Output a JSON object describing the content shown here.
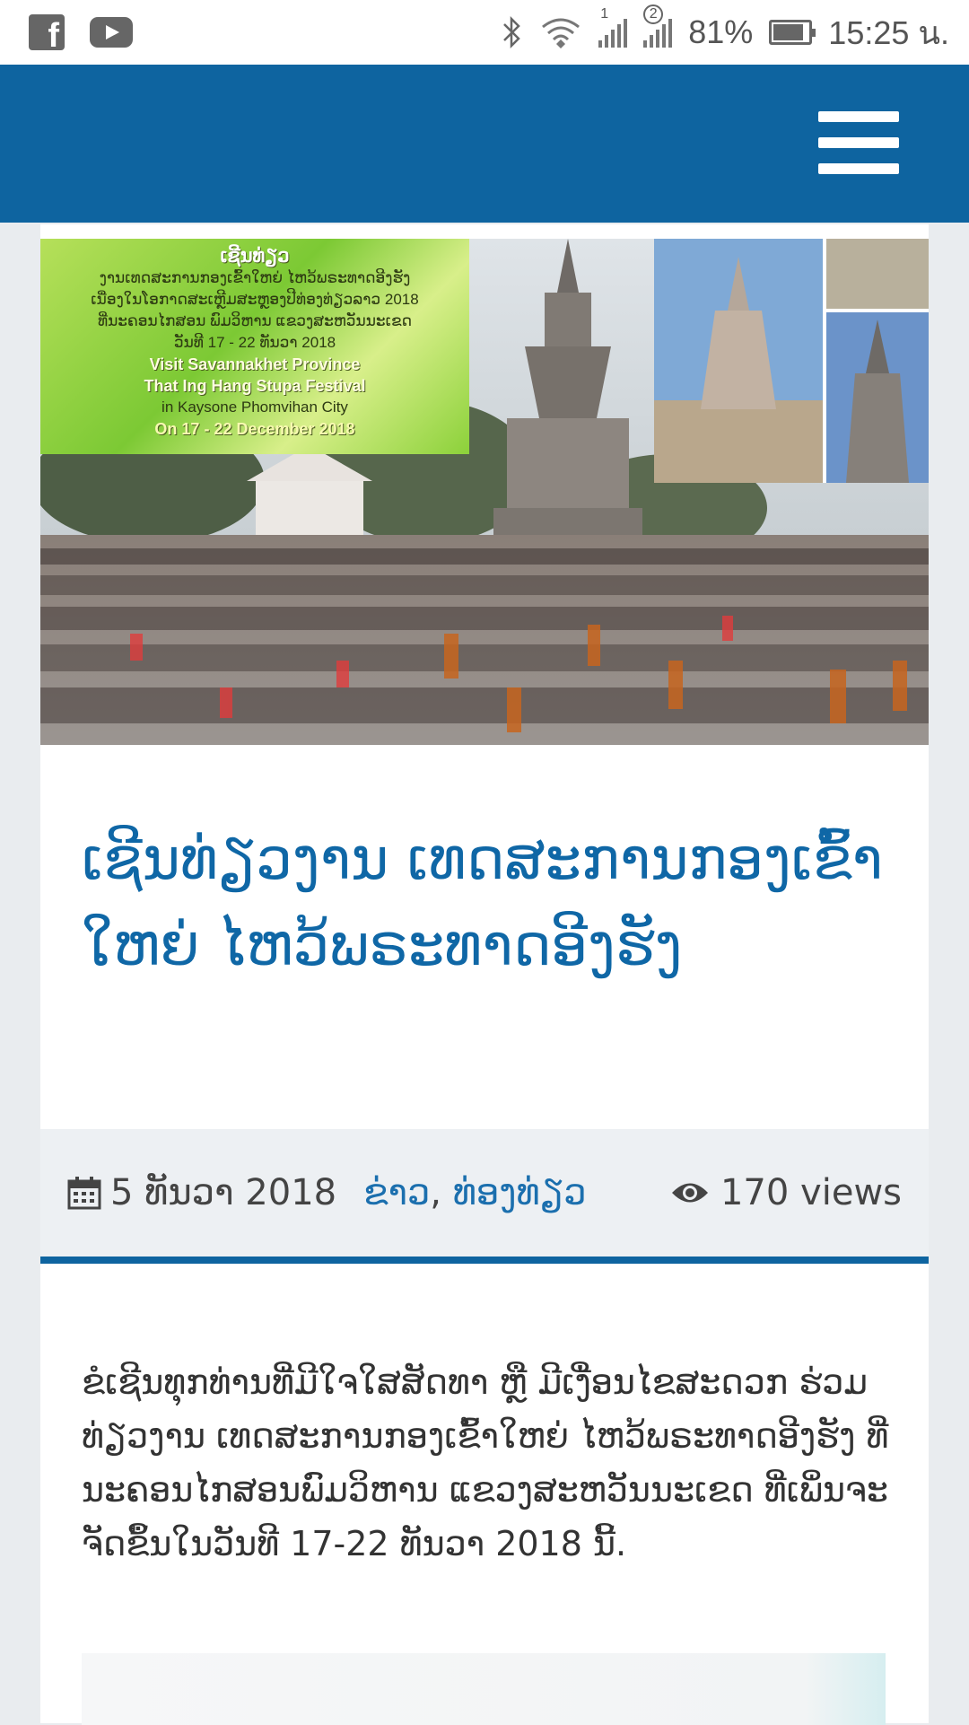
{
  "status_bar": {
    "battery_percent": "81%",
    "time": "15:25 น.",
    "sim1_label": "1",
    "sim2_label": "2",
    "icons": [
      "facebook-icon",
      "youtube-icon",
      "bluetooth-icon",
      "wifi-icon",
      "signal-icon",
      "battery-icon"
    ]
  },
  "header": {
    "menu_icon": "hamburger-menu-icon",
    "background_color": "#0e64a0"
  },
  "hero": {
    "caption_lines": [
      "ເຊີນທ່ຽວ",
      "ງານເທດສະການກອງເຂົ້າໃຫຍ່ ໄຫວ້ພຣະທາດອີງຮັງ",
      "ເນື່ອງໃນໂອກາດສະເຫຼີມສະຫຼອງປີທ່ອງທ່ຽວລາວ 2018",
      "ທີ່ນະຄອນໄກສອນ ພົມວິຫານ ແຂວງສະຫວັນນະເຂດ",
      "ວັນທີ 17 - 22 ທັນວາ 2018",
      "Visit Savannakhet Province",
      "That Ing Hang Stupa Festival",
      "in Kaysone Phomvihan City",
      "On 17 - 22 December 2018"
    ]
  },
  "article": {
    "title": "ເຊີນທ່ຽວງານ ເທດສະການກອງເຂົ້າໃຫຍ່ ໄຫວ້ພຣະທາດອີງຮັງ",
    "date": "5 ທັນວາ 2018",
    "categories": [
      "ຂ່າວ",
      "ທ່ອງທ່ຽວ"
    ],
    "category_separator": ",",
    "views": "170 views",
    "accent_color": "#0f67a6",
    "body": "ຂໍເຊີນທຸກທ່ານທີ່ມີໃຈໃສສັດທາ ຫຼື ມີເງື່ອນໄຂສະດວກ ຮ່ວມທ່ຽວງານ ເທດສະການກອງເຂົ້າໃຫຍ່ ໄຫວ້ພຣະທາດອີງຮັງ ທີ່ນະຄອນໄກສອນພົມວິຫານ ແຂວງສະຫວັນນະເຂດ ທີ່ເພິ່ນຈະຈັດຂຶ້ນໃນວັນທີ 17-22 ທັນວາ 2018 ນີ້."
  }
}
